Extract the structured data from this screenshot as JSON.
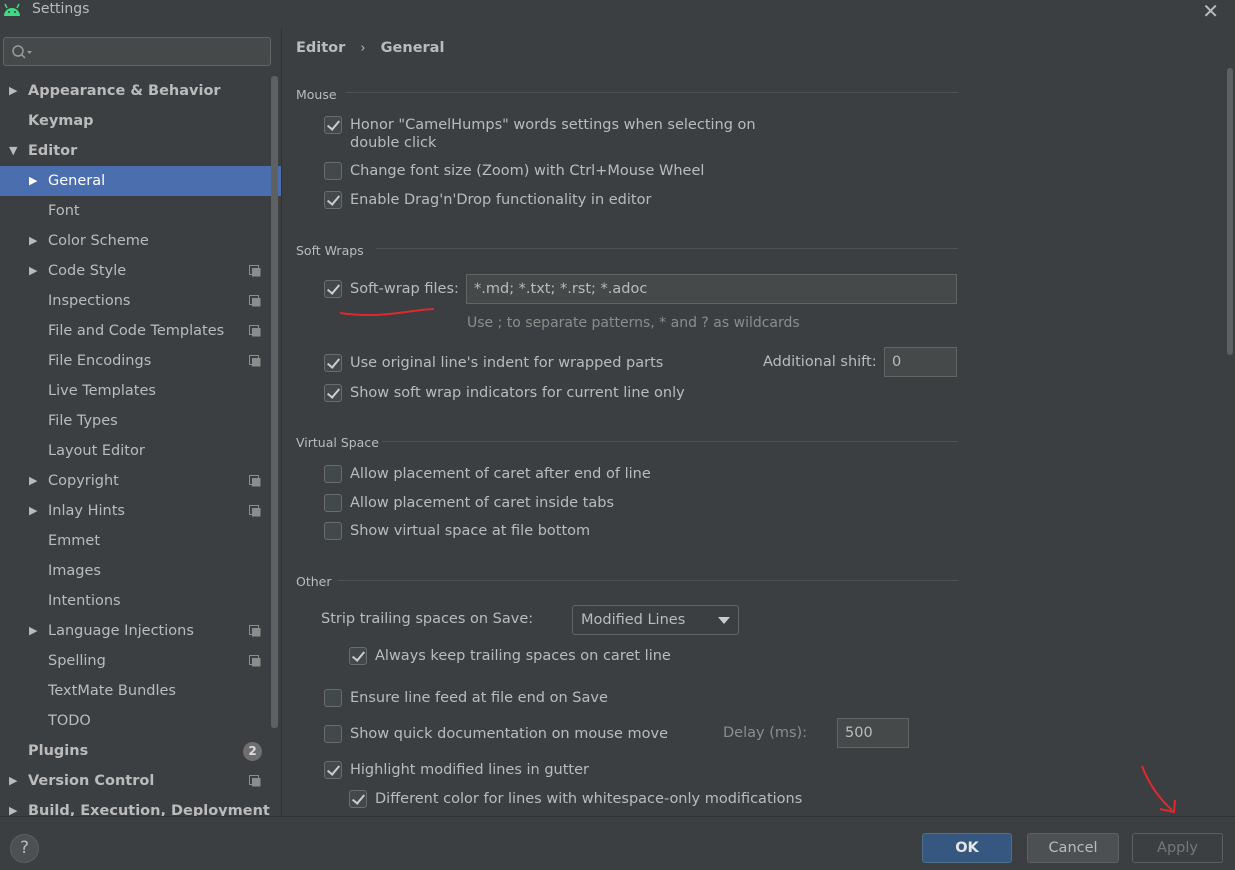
{
  "window": {
    "title": "Settings",
    "app_icon": "android-icon"
  },
  "search": {
    "placeholder": ""
  },
  "sidebar": {
    "items": [
      {
        "label": "Appearance & Behavior",
        "expandable": true,
        "expanded": false
      },
      {
        "label": "Keymap"
      },
      {
        "label": "Editor",
        "expandable": true,
        "expanded": true
      },
      {
        "label": "General",
        "expandable": true,
        "selected": true
      },
      {
        "label": "Font"
      },
      {
        "label": "Color Scheme",
        "expandable": true
      },
      {
        "label": "Code Style",
        "expandable": true,
        "project_icon": true
      },
      {
        "label": "Inspections",
        "project_icon": true
      },
      {
        "label": "File and Code Templates",
        "project_icon": true
      },
      {
        "label": "File Encodings",
        "project_icon": true
      },
      {
        "label": "Live Templates"
      },
      {
        "label": "File Types"
      },
      {
        "label": "Layout Editor"
      },
      {
        "label": "Copyright",
        "expandable": true,
        "project_icon": true
      },
      {
        "label": "Inlay Hints",
        "expandable": true,
        "project_icon": true
      },
      {
        "label": "Emmet"
      },
      {
        "label": "Images"
      },
      {
        "label": "Intentions"
      },
      {
        "label": "Language Injections",
        "expandable": true,
        "project_icon": true
      },
      {
        "label": "Spelling",
        "project_icon": true
      },
      {
        "label": "TextMate Bundles"
      },
      {
        "label": "TODO"
      },
      {
        "label": "Plugins",
        "badge": "2"
      },
      {
        "label": "Version Control",
        "expandable": true,
        "project_icon": true
      },
      {
        "label": "Build, Execution, Deployment",
        "expandable": true
      }
    ]
  },
  "breadcrumb": {
    "parent": "Editor",
    "separator": "›",
    "current": "General"
  },
  "sections": {
    "mouse": {
      "title": "Mouse",
      "options": [
        {
          "label": "Honor \"CamelHumps\" words settings when selecting on",
          "label_line2": "double click",
          "checked": true
        },
        {
          "label": "Change font size (Zoom) with Ctrl+Mouse Wheel",
          "checked": false
        },
        {
          "label": "Enable Drag'n'Drop functionality in editor",
          "checked": true
        }
      ]
    },
    "soft_wraps": {
      "title": "Soft Wraps",
      "soft_wrap_files": {
        "label": "Soft-wrap files:",
        "checked": true,
        "value": "*.md; *.txt; *.rst; *.adoc"
      },
      "hint": "Use ; to separate patterns, * and ? as wildcards",
      "indent": {
        "label": "Use original line's indent for wrapped parts",
        "checked": true
      },
      "additional_shift": {
        "label": "Additional shift:",
        "value": "0"
      },
      "indicators": {
        "label": "Show soft wrap indicators for current line only",
        "checked": true
      }
    },
    "virtual_space": {
      "title": "Virtual Space",
      "options": [
        {
          "label": "Allow placement of caret after end of line",
          "checked": false
        },
        {
          "label": "Allow placement of caret inside tabs",
          "checked": false
        },
        {
          "label": "Show virtual space at file bottom",
          "checked": false
        }
      ]
    },
    "other": {
      "title": "Other",
      "strip_label": "Strip trailing spaces on Save:",
      "strip_value": "Modified Lines",
      "keep_trailing": {
        "label": "Always keep trailing spaces on caret line",
        "checked": true
      },
      "line_feed": {
        "label": "Ensure line feed at file end on Save",
        "checked": false
      },
      "quick_doc": {
        "label": "Show quick documentation on mouse move",
        "checked": false
      },
      "delay": {
        "label": "Delay (ms):",
        "value": "500"
      },
      "highlight_modified": {
        "label": "Highlight modified lines in gutter",
        "checked": true
      },
      "different_color": {
        "label": "Different color for lines with whitespace-only modifications",
        "checked": true
      }
    }
  },
  "footer": {
    "help": "?",
    "ok": "OK",
    "cancel": "Cancel",
    "apply": "Apply"
  },
  "colors": {
    "background": "#3c3f41",
    "selection": "#4b6eaf",
    "ok_button": "#365880",
    "annotation": "#e0282e"
  }
}
